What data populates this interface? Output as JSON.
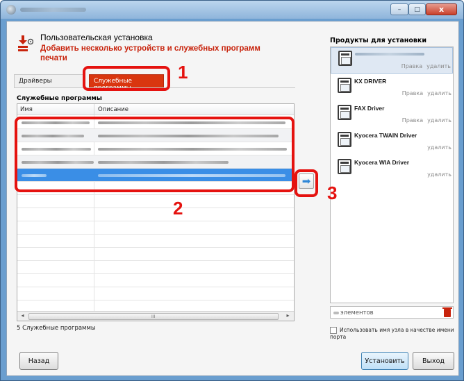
{
  "header": {
    "title": "Пользовательская установка",
    "subtitle": "Добавить несколько устройств и служебных программ печати"
  },
  "tabs": {
    "drivers": "Драйверы",
    "utilities": "Служебные программы"
  },
  "section_title": "Служебные программы",
  "list": {
    "columns": [
      "Имя",
      "Описание"
    ],
    "scroll_grip": "III",
    "scroll_left": "◂",
    "scroll_right": "▸"
  },
  "count_text": "5 Служебные программы",
  "arrow_glyph": "➡",
  "annotations": [
    "1",
    "2",
    "3"
  ],
  "right_panel": {
    "title": "Продукты для установки",
    "products": [
      {
        "name": "",
        "links": [
          "Правка",
          "удалить"
        ]
      },
      {
        "name": "KX DRIVER",
        "links": [
          "Правка",
          "удалить"
        ]
      },
      {
        "name": "FAX Driver",
        "links": [
          "Правка",
          "удалить"
        ]
      },
      {
        "name": "Kyocera TWAIN Driver",
        "links": [
          "удалить"
        ]
      },
      {
        "name": "Kyocera WIA Driver",
        "links": [
          "удалить"
        ]
      }
    ],
    "count_label": "элементов",
    "checkbox_label": "Использовать имя узла в качестве имени порта"
  },
  "buttons": {
    "back": "Назад",
    "install": "Установить",
    "exit": "Выход"
  },
  "window_buttons": {
    "min": "–",
    "max": "□",
    "close": "x"
  },
  "colors": {
    "accent_red": "#c8230c",
    "annotation_red": "#e5120f",
    "selection_blue": "#3a8ee6"
  }
}
